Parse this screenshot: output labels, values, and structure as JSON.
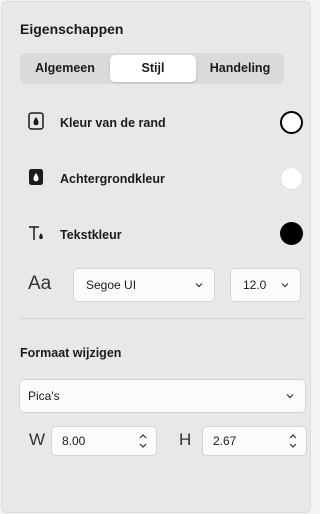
{
  "panel": {
    "title": "Eigenschappen"
  },
  "tabs": [
    {
      "label": "Algemeen"
    },
    {
      "label": "Stijl"
    },
    {
      "label": "Handeling"
    }
  ],
  "active_tab": "Stijl",
  "style": {
    "border_color_label": "Kleur van de rand",
    "background_color_label": "Achtergrondkleur",
    "text_color_label": "Tekstkleur",
    "border_color": "#000000",
    "background_color": "#ffffff",
    "text_color": "#000000",
    "font_family": "Segoe UI",
    "font_size": "12.0",
    "font_icon_text": "Aa"
  },
  "resize": {
    "section_label": "Formaat wijzigen",
    "unit": "Pica's",
    "width_label": "W",
    "width_value": "8.00",
    "height_label": "H",
    "height_value": "2.67"
  }
}
